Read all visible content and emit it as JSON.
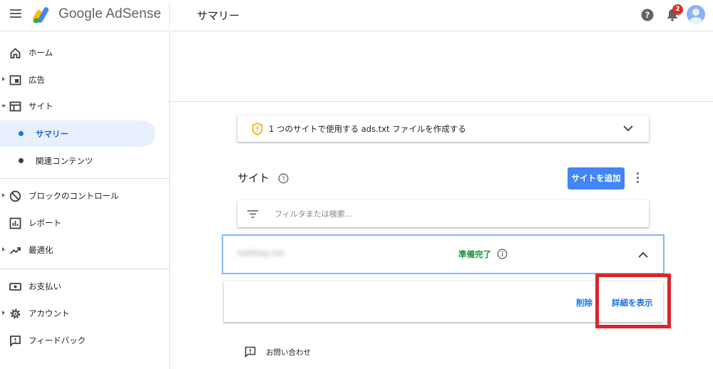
{
  "app": {
    "name": "Google AdSense",
    "page_title": "サマリー",
    "notification_count": "2"
  },
  "sidebar": {
    "items": [
      {
        "label": "ホーム",
        "icon": "home-icon"
      },
      {
        "label": "広告",
        "icon": "ads-icon"
      },
      {
        "label": "サイト",
        "icon": "sites-icon"
      },
      {
        "label": "サマリー"
      },
      {
        "label": "関連コンテンツ"
      },
      {
        "label": "ブロックのコントロール",
        "icon": "block-icon"
      },
      {
        "label": "レポート",
        "icon": "reports-icon"
      },
      {
        "label": "最適化",
        "icon": "trending-icon"
      },
      {
        "label": "お支払い",
        "icon": "payments-icon"
      },
      {
        "label": "アカウント",
        "icon": "gear-icon"
      },
      {
        "label": "フィードバック",
        "icon": "feedback-icon"
      }
    ]
  },
  "main": {
    "ads_txt_notice": "1 つのサイトで使用する ads.txt ファイルを作成する",
    "section_title": "サイト",
    "add_site_label": "サイトを追加",
    "filter_placeholder": "フィルタまたは検索...",
    "site": {
      "name": "hatblog.net",
      "status": "準備完了",
      "delete_label": "削除",
      "details_label": "詳細を表示"
    },
    "contact_label": "お問い合わせ"
  },
  "colors": {
    "accent": "#4285f4",
    "link": "#1a73e8",
    "status_ready": "#1e8e3e",
    "highlight": "#d9262c",
    "badge": "#d93025"
  }
}
